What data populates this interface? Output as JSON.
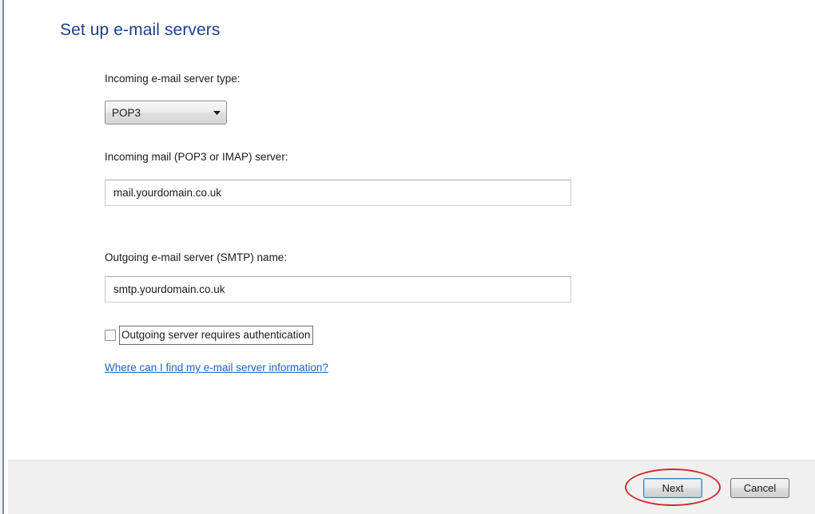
{
  "page": {
    "title": "Set up e-mail servers"
  },
  "form": {
    "incoming_type_label": "Incoming e-mail server type:",
    "incoming_type_value": "POP3",
    "incoming_server_label": "Incoming mail (POP3 or IMAP) server:",
    "incoming_server_value": "mail.yourdomain.co.uk",
    "outgoing_server_label": "Outgoing e-mail server (SMTP) name:",
    "outgoing_server_value": "smtp.yourdomain.co.uk",
    "auth_checkbox_label": "Outgoing server requires authentication",
    "auth_checkbox_checked": false,
    "help_link": "Where can I find my e-mail server information?"
  },
  "footer": {
    "next_label": "Next",
    "cancel_label": "Cancel"
  },
  "annotation": {
    "highlight_color": "#d42a2a",
    "highlighted_element": "next-button"
  },
  "colors": {
    "title": "#1e3f8a",
    "link": "#1c62c8",
    "footer_bg": "#f0f0f0"
  }
}
